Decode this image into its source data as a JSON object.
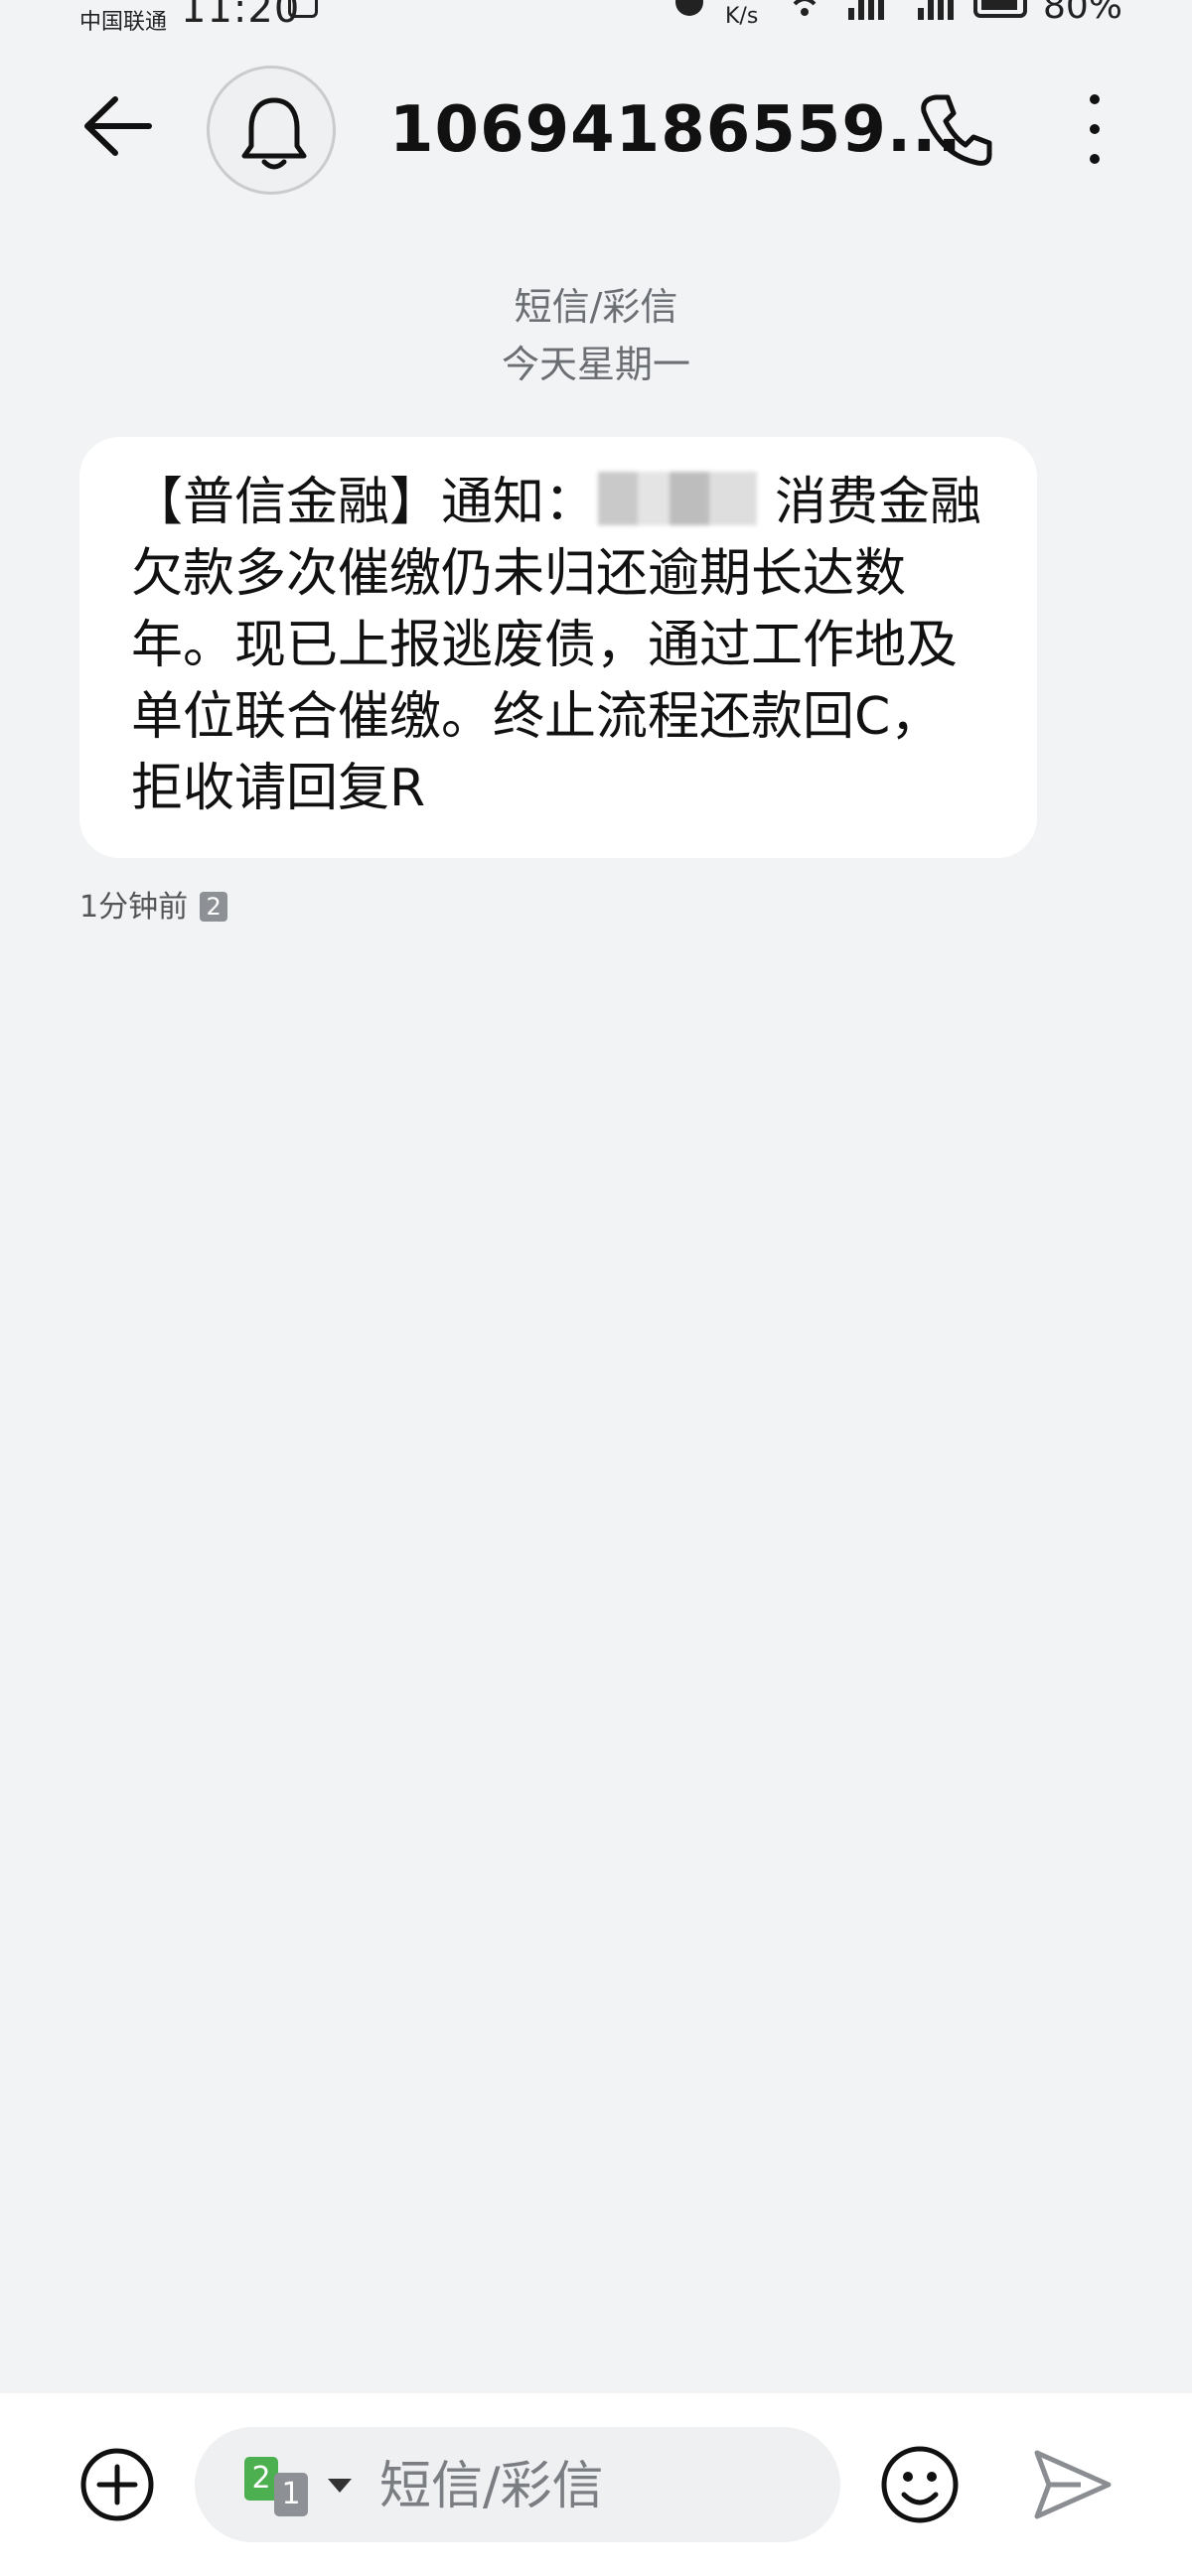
{
  "status_bar": {
    "carrier": "中国联通",
    "time": "11:20",
    "net_speed_unit": "K/s",
    "battery": "80%"
  },
  "header": {
    "title": "10694186559...",
    "back_icon": "back-arrow-icon",
    "avatar_icon": "bell-icon",
    "phone_icon": "phone-icon",
    "more_icon": "more-vertical-icon"
  },
  "thread": {
    "type_label": "短信/彩信",
    "date_label": "今天星期一"
  },
  "message": {
    "text_before": "【普信金融】通知：",
    "text_after": "消费金融欠款多次催缴仍未归还逾期长达数年。现已上报逃废债，通过工作地及单位联合催缴。终止流程还款回C，拒收请回复R",
    "time": "1分钟前",
    "sim_badge": "2"
  },
  "composer": {
    "sim_primary": "2",
    "sim_secondary": "1",
    "placeholder": "短信/彩信",
    "add_icon": "add-circle-icon",
    "emoji_icon": "emoji-icon",
    "send_icon": "send-icon"
  }
}
